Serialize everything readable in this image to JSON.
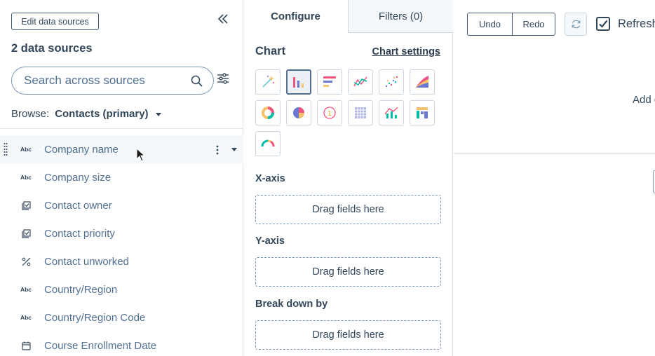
{
  "left": {
    "edit_button": "Edit data sources",
    "sources_title": "2 data sources",
    "search_placeholder": "Search across sources",
    "browse_label": "Browse:",
    "browse_value": "Contacts (primary)",
    "fields": [
      {
        "label": "Company name",
        "type": "Abc",
        "icon": "text-type-icon"
      },
      {
        "label": "Company size",
        "type": "Abc",
        "icon": "text-type-icon"
      },
      {
        "label": "Contact owner",
        "type": "",
        "icon": "owner-type-icon"
      },
      {
        "label": "Contact priority",
        "type": "",
        "icon": "enum-type-icon"
      },
      {
        "label": "Contact unworked",
        "type": "",
        "icon": "boolean-type-icon"
      },
      {
        "label": "Country/Region",
        "type": "Abc",
        "icon": "text-type-icon"
      },
      {
        "label": "Country/Region Code",
        "type": "Abc",
        "icon": "text-type-icon"
      },
      {
        "label": "Course Enrollment Date",
        "type": "",
        "icon": "date-type-icon"
      }
    ]
  },
  "middle": {
    "tabs": [
      {
        "label": "Configure",
        "active": true
      },
      {
        "label": "Filters (0)",
        "active": false
      }
    ],
    "chart_heading": "Chart",
    "chart_settings": "Chart settings",
    "chart_types": [
      "magic-wand-icon",
      "vertical-bar-chart-icon",
      "horizontal-bar-chart-icon",
      "line-chart-icon",
      "scatter-chart-icon",
      "area-chart-icon",
      "donut-chart-icon",
      "pie-chart-icon",
      "single-value-icon",
      "table-chart-icon",
      "combo-chart-icon",
      "pivot-table-icon",
      "gauge-chart-icon"
    ],
    "selected_chart_type": "vertical-bar-chart-icon",
    "sections": [
      {
        "heading": "X-axis",
        "drop_text": "Drag fields here"
      },
      {
        "heading": "Y-axis",
        "drop_text": "Drag fields here"
      },
      {
        "heading": "Break down by",
        "drop_text": "Drag fields here"
      }
    ]
  },
  "right": {
    "undo": "Undo",
    "redo": "Redo",
    "refresh_label": "Refresh",
    "refresh_checked": true,
    "add_text": "Add d"
  }
}
